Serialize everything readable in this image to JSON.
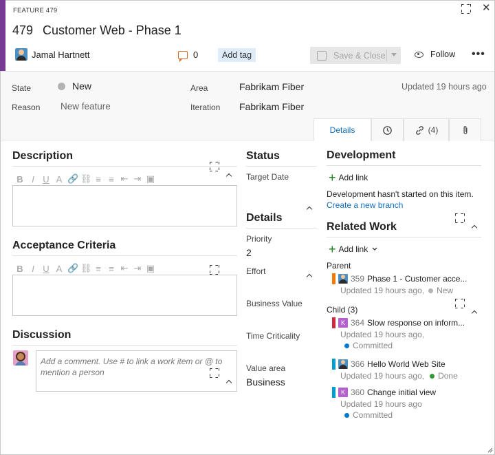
{
  "header": {
    "type_label": "FEATURE 479",
    "id": "479",
    "title": "Customer Web - Phase 1",
    "assignee": "Jamal Hartnett",
    "comment_count": "0",
    "add_tag": "Add tag",
    "save_close": "Save & Close",
    "follow": "Follow",
    "more": "•••",
    "accent_color": "#773b93"
  },
  "fields": {
    "state_label": "State",
    "state_value": "New",
    "reason_label": "Reason",
    "reason_value": "New feature",
    "area_label": "Area",
    "area_value": "Fabrikam Fiber",
    "iteration_label": "Iteration",
    "iteration_value": "Fabrikam Fiber",
    "updated": "Updated 19 hours ago"
  },
  "tabs": {
    "details": "Details",
    "links_count": "(4)"
  },
  "left": {
    "description_title": "Description",
    "acceptance_title": "Acceptance Criteria",
    "discussion_title": "Discussion",
    "discussion_placeholder": "Add a comment. Use # to link a work item or @ to mention a person",
    "toolbar": [
      "B",
      "I",
      "U",
      "A",
      "🔗",
      "⛓",
      "≡",
      "≡",
      "⇤",
      "⇥",
      "▣"
    ]
  },
  "middle": {
    "status_title": "Status",
    "target_date_label": "Target Date",
    "details_title": "Details",
    "priority_label": "Priority",
    "priority_value": "2",
    "effort_label": "Effort",
    "business_value_label": "Business Value",
    "time_criticality_label": "Time Criticality",
    "value_area_label": "Value area",
    "value_area_value": "Business"
  },
  "right": {
    "development_title": "Development",
    "add_link": "Add link",
    "dev_message": "Development hasn't started on this item.",
    "create_branch": "Create a new branch",
    "related_title": "Related Work",
    "parent_label": "Parent",
    "child_label": "Child (3)",
    "items": [
      {
        "id": "359",
        "title": "Phase 1 - Customer acce...",
        "meta": "Updated 19 hours ago,",
        "state": "New",
        "bar_color": "#f07b05",
        "state_color": "#b2b2b2",
        "avatar": "user"
      },
      {
        "id": "364",
        "title": "Slow response on inform...",
        "meta": "Updated 19 hours ago,",
        "state": "Committed",
        "bar_color": "#cc293d",
        "state_color": "#007acc",
        "avatar": "K"
      },
      {
        "id": "366",
        "title": "Hello World Web Site",
        "meta": "Updated 19 hours ago,",
        "state": "Done",
        "bar_color": "#009ccc",
        "state_color": "#339933",
        "avatar": "user"
      },
      {
        "id": "360",
        "title": "Change initial view",
        "meta": "Updated 19 hours ago",
        "state": "Committed",
        "bar_color": "#009ccc",
        "state_color": "#007acc",
        "avatar": "K"
      }
    ]
  }
}
